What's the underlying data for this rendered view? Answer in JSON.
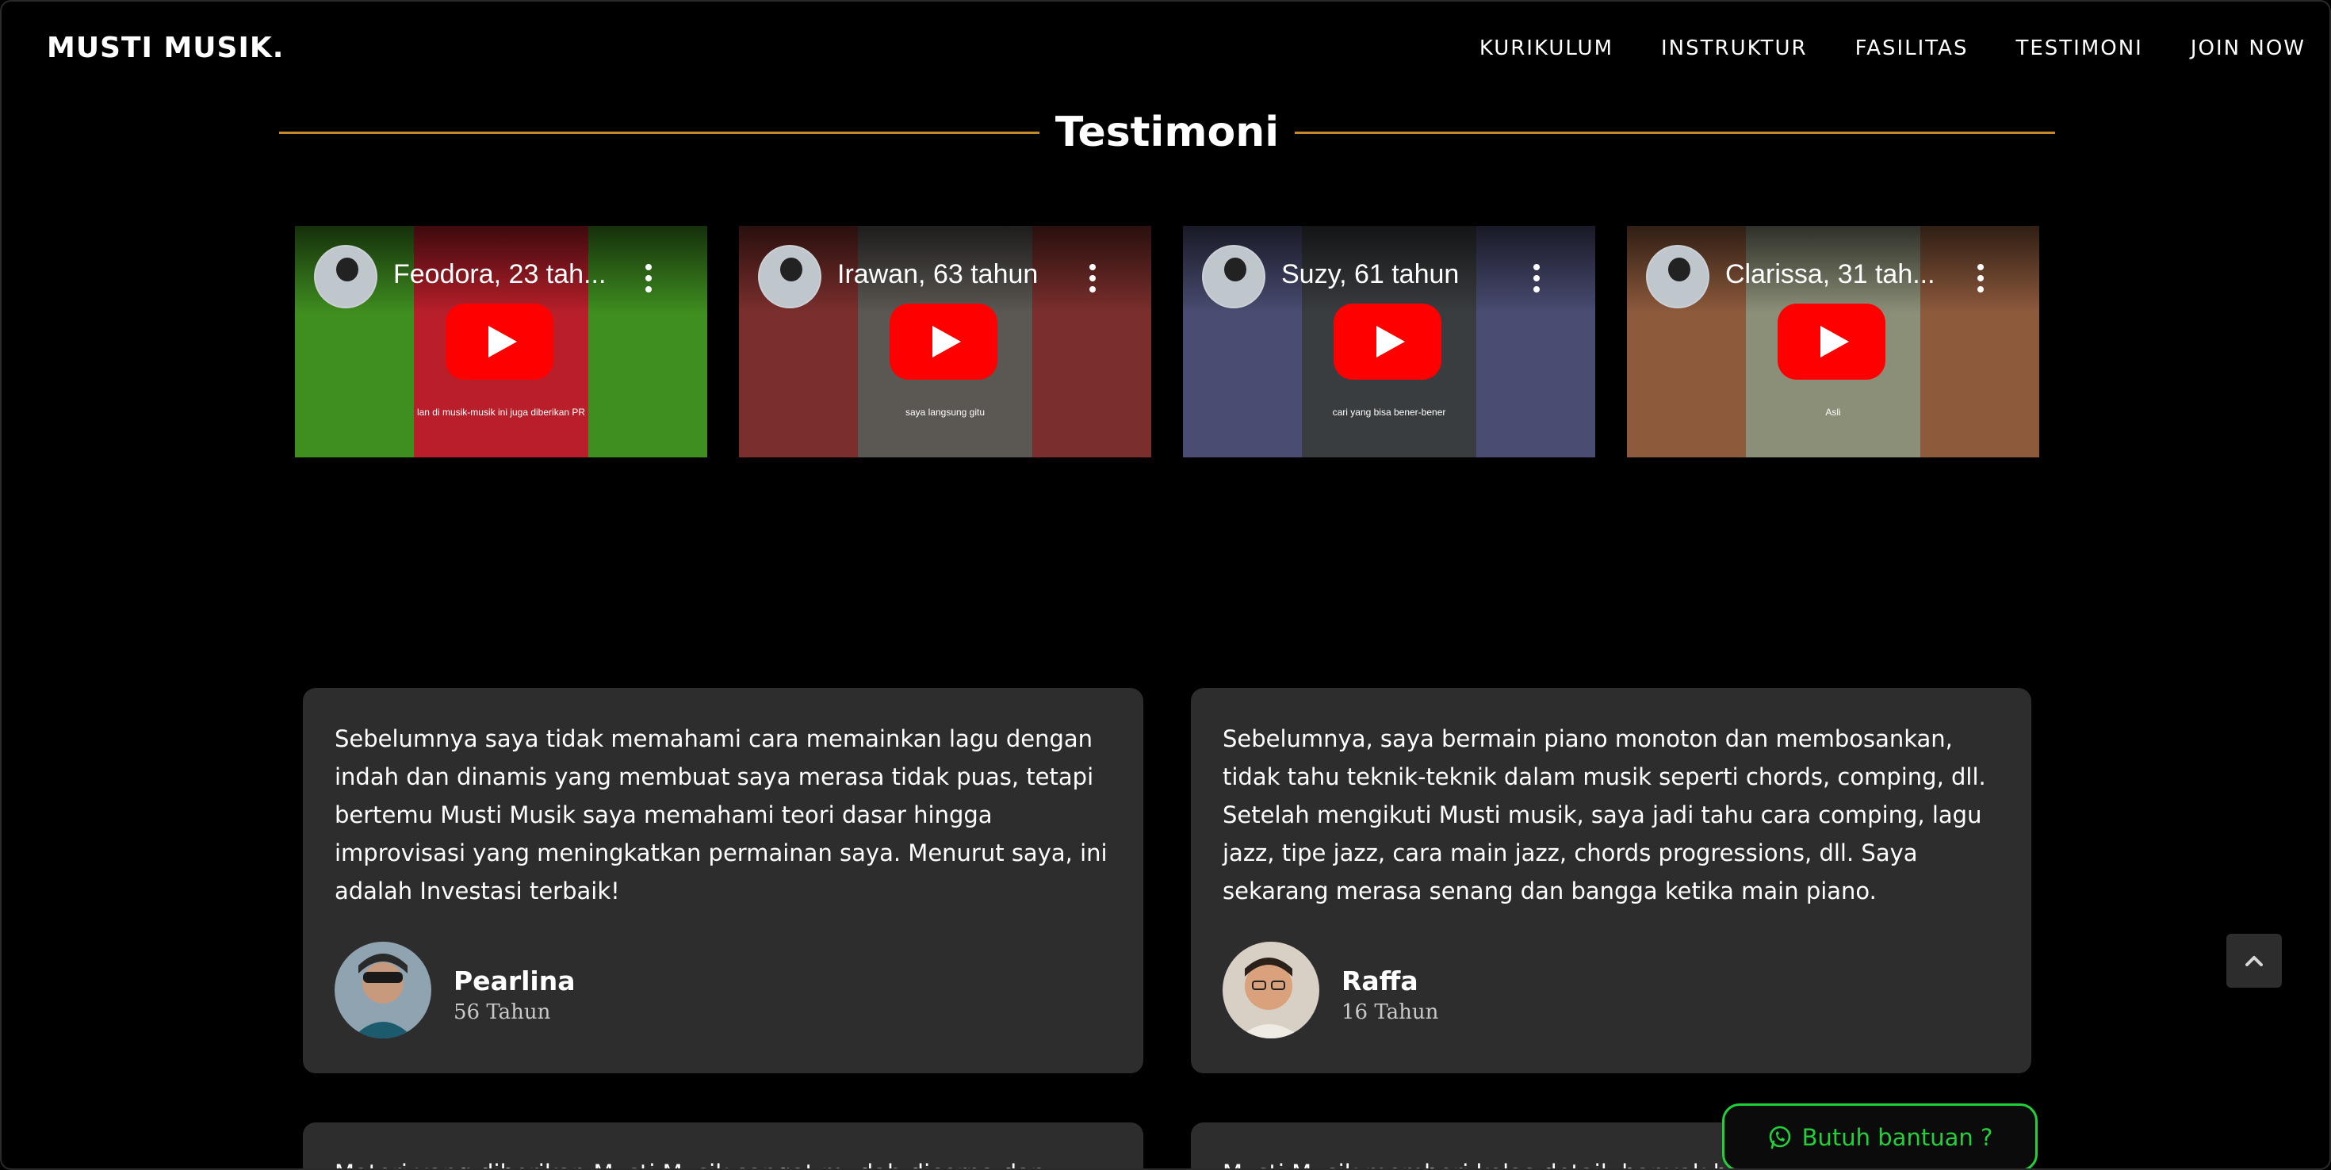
{
  "brand": {
    "logo": "MUSTI MUSIK."
  },
  "nav": [
    "KURIKULUM",
    "INSTRUKTUR",
    "FASILITAS",
    "TESTIMONI",
    "JOIN NOW"
  ],
  "section": {
    "title": "Testimoni"
  },
  "videos": [
    {
      "title": "Feodora, 23 tah...",
      "caption": "lan di musik-musik ini juga diberikan PR",
      "bg": "#3f8e20"
    },
    {
      "title": "Irawan, 63 tahun",
      "caption": "saya langsung gitu",
      "bg": "#7b2f2c"
    },
    {
      "title": "Suzy, 61 tahun",
      "caption": "cari yang bisa bener-bener",
      "bg": "#4a4c72"
    },
    {
      "title": "Clarissa, 31 tah...",
      "caption": "Asli",
      "bg": "#8e5a3c"
    }
  ],
  "testimonials": [
    {
      "quote": "Sebelumnya saya tidak memahami cara memainkan lagu dengan indah dan dinamis yang membuat saya merasa tidak puas, tetapi bertemu Musti Musik saya memahami teori dasar hingga improvisasi yang meningkatkan permainan saya. Menurut saya, ini adalah Investasi terbaik!",
      "name": "Pearlina",
      "age": "56 Tahun"
    },
    {
      "quote": "Sebelumnya, saya bermain piano monoton dan membosankan, tidak tahu teknik-teknik dalam musik seperti chords, comping, dll. Setelah mengikuti Musti musik, saya jadi tahu cara comping, lagu jazz, tipe jazz, cara main jazz, chords progressions, dll. Saya sekarang merasa senang dan bangga ketika main piano.",
      "name": "Raffa",
      "age": "16 Tahun"
    },
    {
      "quote": "Materi yang diberikan Musti Musik sangat mudah dicerna dan",
      "name": "",
      "age": ""
    },
    {
      "quote": "Musti Musik memberi kelas detail, banyak banget materinya",
      "name": "",
      "age": ""
    }
  ],
  "help_button": {
    "label": "Butuh bantuan ?"
  },
  "icons": {
    "back_to_top": "chevron-up-icon",
    "whatsapp": "whatsapp-icon",
    "play": "play-icon",
    "more": "more-vertical-icon"
  },
  "colors": {
    "accent_line": "#c58a2c",
    "help_green": "#22d13a",
    "card_bg": "#2d2d2d",
    "youtube_red": "#ff0000"
  }
}
